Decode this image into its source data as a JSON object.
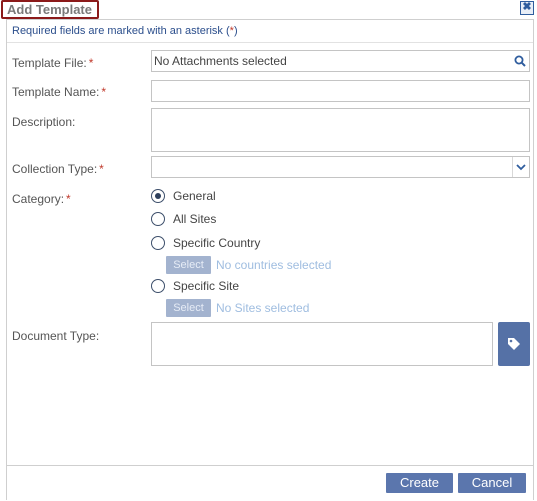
{
  "dialog": {
    "title": "Add Template",
    "close_label": "✖",
    "required_note_prefix": "Required fields are marked with an asterisk (",
    "required_note_star": "*",
    "required_note_suffix": ")"
  },
  "form": {
    "template_file": {
      "label": "Template File:",
      "required_mark": "*",
      "value": "No Attachments selected"
    },
    "template_name": {
      "label": "Template Name:",
      "required_mark": "*",
      "value": ""
    },
    "description": {
      "label": "Description:",
      "value": ""
    },
    "collection_type": {
      "label": "Collection Type:",
      "required_mark": "*",
      "selected": ""
    },
    "category": {
      "label": "Category:",
      "required_mark": "*",
      "selected": "General",
      "options": [
        {
          "label": "General"
        },
        {
          "label": "All Sites"
        },
        {
          "label": "Specific Country",
          "select_label": "Select",
          "status": "No countries selected"
        },
        {
          "label": "Specific Site",
          "select_label": "Select",
          "status": "No Sites selected"
        }
      ]
    },
    "document_type": {
      "label": "Document Type:",
      "value": ""
    }
  },
  "footer": {
    "create_label": "Create",
    "cancel_label": "Cancel"
  },
  "colors": {
    "accent": "#5b76ad",
    "required_star": "#c0392b",
    "title_outline": "#8b1a1a",
    "disabled_text": "#9fbde0"
  },
  "icons": {
    "search": "search-icon",
    "dropdown": "chevron-down-icon",
    "tag": "tag-icon",
    "close": "close-icon"
  }
}
